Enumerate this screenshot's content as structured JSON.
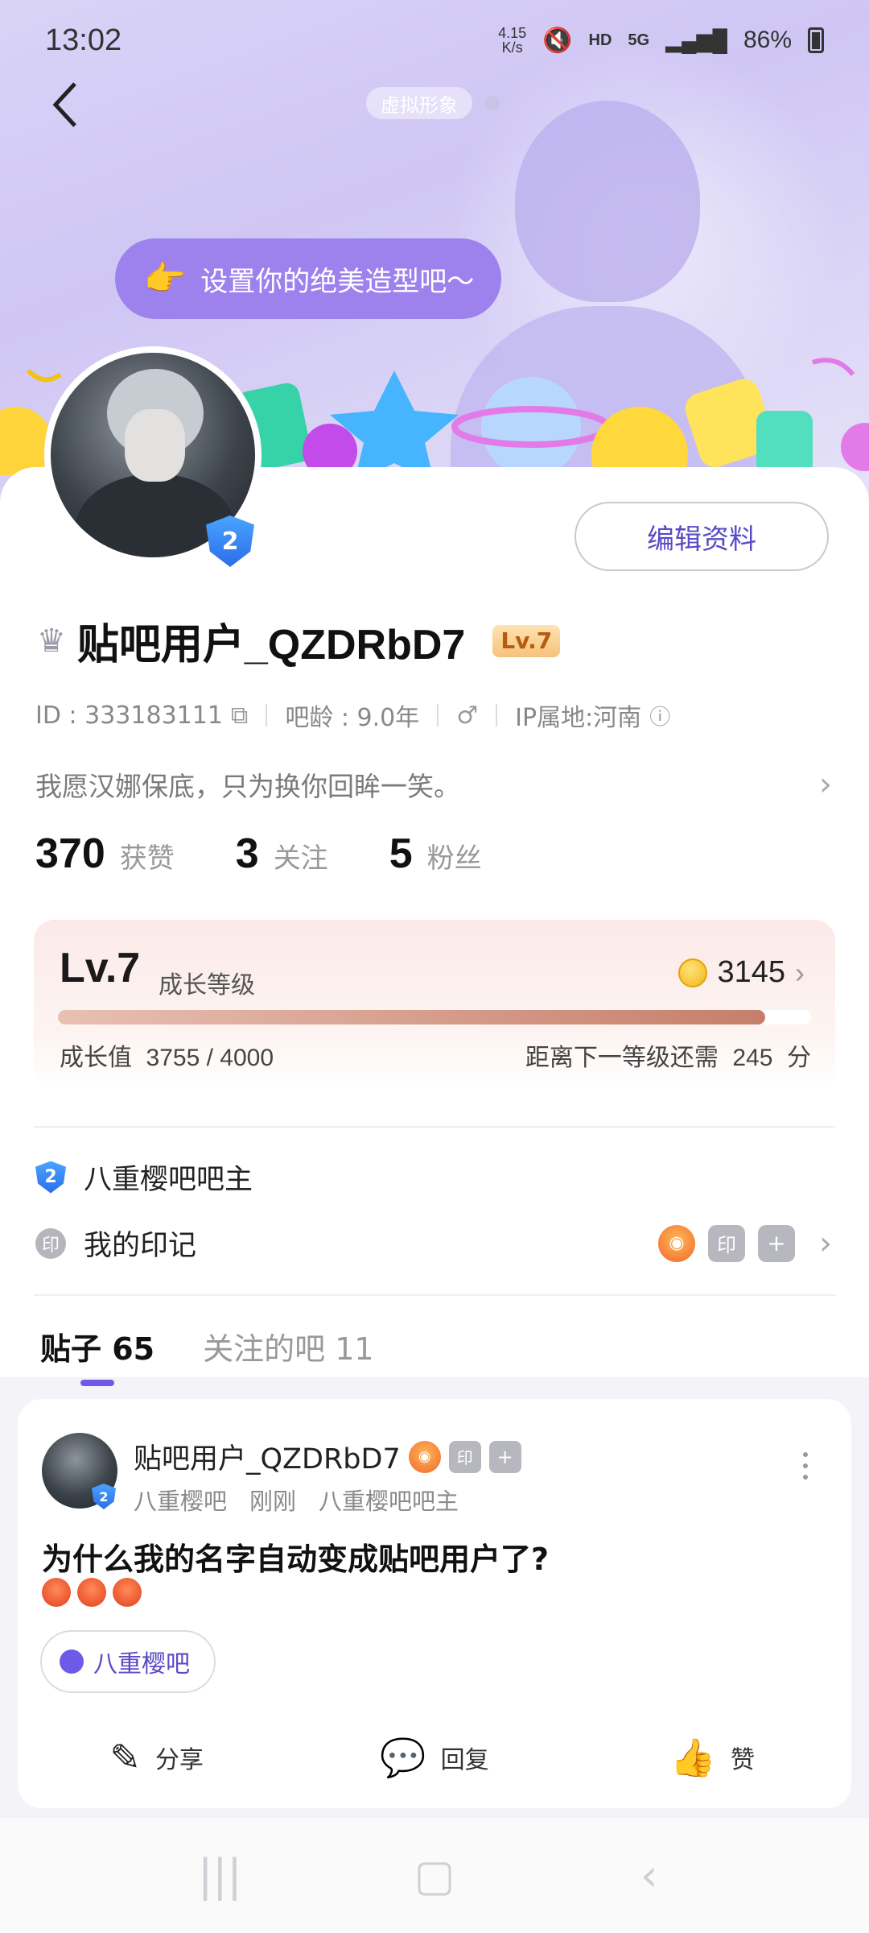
{
  "status_bar": {
    "time": "13:02",
    "net_speed_top": "4.15",
    "net_speed_bottom": "K/s",
    "hd": "HD",
    "network": "5G",
    "battery": "86%"
  },
  "header": {
    "avatar_chip": "虚拟形象",
    "style_prompt": "设置你的绝美造型吧～"
  },
  "profile": {
    "edit_label": "编辑资料",
    "username": "贴吧用户_QZDRbD7",
    "level_badge": "Lv.7",
    "avatar_level": "2",
    "id_text": "ID : 333183111",
    "bar_age": "吧龄 : 9.0年",
    "ip": "IP属地:河南",
    "bio": "我愿汉娜保底，只为换你回眸一笑。"
  },
  "stats": [
    {
      "num": "370",
      "label": "获赞"
    },
    {
      "num": "3",
      "label": "关注"
    },
    {
      "num": "5",
      "label": "粉丝"
    }
  ],
  "level_panel": {
    "title": "Lv.7",
    "subtitle": "成长等级",
    "coins": "3145",
    "growth_label": "成长值",
    "growth_value": "3755 / 4000",
    "growth_fraction": 0.9388,
    "next_label": "距离下一等级还需",
    "next_value": "245",
    "next_unit": "分"
  },
  "bar_master": {
    "label": "八重樱吧吧主",
    "shield": "2"
  },
  "marks": {
    "label": "我的印记",
    "seal": "印",
    "square_seal": "印",
    "add": "+"
  },
  "tabs": {
    "posts": "贴子 65",
    "followed_bars": "关注的吧 11"
  },
  "post": {
    "user": "贴吧用户_QZDRbD7",
    "seal": "印",
    "add": "+",
    "shield": "2",
    "forum": "八重樱吧",
    "time": "刚刚",
    "role": "八重樱吧吧主",
    "title": "为什么我的名字自动变成贴吧用户了?",
    "forum_chip": "八重樱吧",
    "share": "分享",
    "reply": "回复",
    "like": "赞"
  }
}
